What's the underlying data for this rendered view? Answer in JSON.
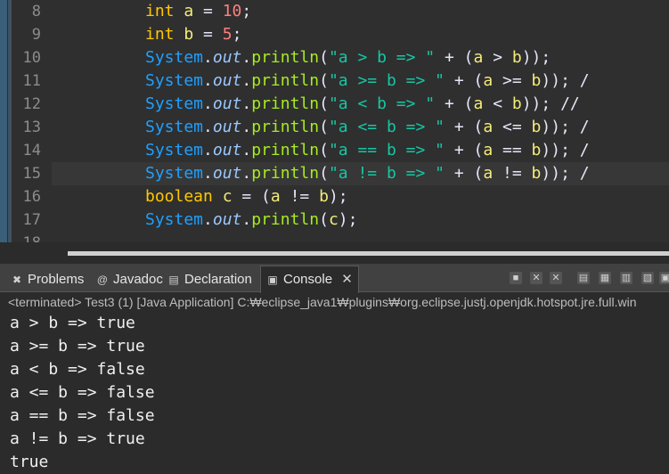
{
  "editor": {
    "line_numbers": [
      "8",
      "9",
      "10",
      "11",
      "12",
      "13",
      "14",
      "15",
      "16",
      "17",
      "18"
    ],
    "lines": [
      [
        {
          "t": "int",
          "c": "kw"
        },
        {
          "t": " ",
          "c": "op"
        },
        {
          "t": "a",
          "c": "var"
        },
        {
          "t": " = ",
          "c": "op"
        },
        {
          "t": "10",
          "c": "num"
        },
        {
          "t": ";",
          "c": "op"
        }
      ],
      [
        {
          "t": "int",
          "c": "kw"
        },
        {
          "t": " ",
          "c": "op"
        },
        {
          "t": "b",
          "c": "var"
        },
        {
          "t": " = ",
          "c": "op"
        },
        {
          "t": "5",
          "c": "num"
        },
        {
          "t": ";",
          "c": "op"
        }
      ],
      [
        {
          "t": "System",
          "c": "sys"
        },
        {
          "t": ".",
          "c": "op"
        },
        {
          "t": "out",
          "c": "out"
        },
        {
          "t": ".",
          "c": "op"
        },
        {
          "t": "println",
          "c": "meth"
        },
        {
          "t": "(",
          "c": "op"
        },
        {
          "t": "\"a > b => \"",
          "c": "str"
        },
        {
          "t": " + (",
          "c": "op"
        },
        {
          "t": "a",
          "c": "var"
        },
        {
          "t": " > ",
          "c": "op"
        },
        {
          "t": "b",
          "c": "var"
        },
        {
          "t": "));",
          "c": "op"
        }
      ],
      [
        {
          "t": "System",
          "c": "sys"
        },
        {
          "t": ".",
          "c": "op"
        },
        {
          "t": "out",
          "c": "out"
        },
        {
          "t": ".",
          "c": "op"
        },
        {
          "t": "println",
          "c": "meth"
        },
        {
          "t": "(",
          "c": "op"
        },
        {
          "t": "\"a >= b => \"",
          "c": "str"
        },
        {
          "t": " + (",
          "c": "op"
        },
        {
          "t": "a",
          "c": "var"
        },
        {
          "t": " >= ",
          "c": "op"
        },
        {
          "t": "b",
          "c": "var"
        },
        {
          "t": ")); /",
          "c": "op"
        }
      ],
      [
        {
          "t": "System",
          "c": "sys"
        },
        {
          "t": ".",
          "c": "op"
        },
        {
          "t": "out",
          "c": "out"
        },
        {
          "t": ".",
          "c": "op"
        },
        {
          "t": "println",
          "c": "meth"
        },
        {
          "t": "(",
          "c": "op"
        },
        {
          "t": "\"a < b => \"",
          "c": "str"
        },
        {
          "t": " + (",
          "c": "op"
        },
        {
          "t": "a",
          "c": "var"
        },
        {
          "t": " < ",
          "c": "op"
        },
        {
          "t": "b",
          "c": "var"
        },
        {
          "t": ")); //",
          "c": "op"
        }
      ],
      [
        {
          "t": "System",
          "c": "sys"
        },
        {
          "t": ".",
          "c": "op"
        },
        {
          "t": "out",
          "c": "out"
        },
        {
          "t": ".",
          "c": "op"
        },
        {
          "t": "println",
          "c": "meth"
        },
        {
          "t": "(",
          "c": "op"
        },
        {
          "t": "\"a <= b => \"",
          "c": "str"
        },
        {
          "t": " + (",
          "c": "op"
        },
        {
          "t": "a",
          "c": "var"
        },
        {
          "t": " <= ",
          "c": "op"
        },
        {
          "t": "b",
          "c": "var"
        },
        {
          "t": ")); /",
          "c": "op"
        }
      ],
      [
        {
          "t": "System",
          "c": "sys"
        },
        {
          "t": ".",
          "c": "op"
        },
        {
          "t": "out",
          "c": "out"
        },
        {
          "t": ".",
          "c": "op"
        },
        {
          "t": "println",
          "c": "meth"
        },
        {
          "t": "(",
          "c": "op"
        },
        {
          "t": "\"a == b => \"",
          "c": "str"
        },
        {
          "t": " + (",
          "c": "op"
        },
        {
          "t": "a",
          "c": "var"
        },
        {
          "t": " == ",
          "c": "op"
        },
        {
          "t": "b",
          "c": "var"
        },
        {
          "t": ")); /",
          "c": "op"
        }
      ],
      [
        {
          "t": "System",
          "c": "sys"
        },
        {
          "t": ".",
          "c": "op"
        },
        {
          "t": "out",
          "c": "out"
        },
        {
          "t": ".",
          "c": "op"
        },
        {
          "t": "println",
          "c": "meth"
        },
        {
          "t": "(",
          "c": "op"
        },
        {
          "t": "\"a != b => \"",
          "c": "str"
        },
        {
          "t": " + (",
          "c": "op"
        },
        {
          "t": "a",
          "c": "var"
        },
        {
          "t": " != ",
          "c": "op"
        },
        {
          "t": "b",
          "c": "var"
        },
        {
          "t": ")); /",
          "c": "op"
        }
      ],
      [
        {
          "t": "boolean",
          "c": "kw"
        },
        {
          "t": " ",
          "c": "op"
        },
        {
          "t": "c",
          "c": "var"
        },
        {
          "t": " = (",
          "c": "op"
        },
        {
          "t": "a",
          "c": "var"
        },
        {
          "t": " != ",
          "c": "op"
        },
        {
          "t": "b",
          "c": "var"
        },
        {
          "t": ");",
          "c": "op"
        }
      ],
      [
        {
          "t": "System",
          "c": "sys"
        },
        {
          "t": ".",
          "c": "op"
        },
        {
          "t": "out",
          "c": "out"
        },
        {
          "t": ".",
          "c": "op"
        },
        {
          "t": "println",
          "c": "meth"
        },
        {
          "t": "(",
          "c": "op"
        },
        {
          "t": "c",
          "c": "var"
        },
        {
          "t": ");",
          "c": "op"
        }
      ],
      []
    ],
    "current_line_index": 7
  },
  "tabs": [
    {
      "label": "Problems",
      "icon": "problems-icon",
      "glyph": "✖"
    },
    {
      "label": "Javadoc",
      "icon": "javadoc-icon",
      "glyph": "@"
    },
    {
      "label": "Declaration",
      "icon": "declaration-icon",
      "glyph": "▤"
    },
    {
      "label": "Console",
      "icon": "console-icon",
      "glyph": "▣",
      "active": true
    }
  ],
  "console": {
    "status": "<terminated> Test3 (1) [Java Application] C:₩eclipse_java1₩plugins₩org.eclipse.justj.openjdk.hotspot.jre.full.win",
    "output": [
      "a > b => true",
      "a >= b => true",
      "a < b => false",
      "a <= b => false",
      "a == b => false",
      "a != b => true",
      "true"
    ]
  },
  "colors": {
    "keyword": "#ffc800",
    "class": "#1fa0ff",
    "method": "#a7ec21",
    "string": "#17c6a3",
    "variable": "#f3ec79",
    "number": "#ff7f7f"
  }
}
